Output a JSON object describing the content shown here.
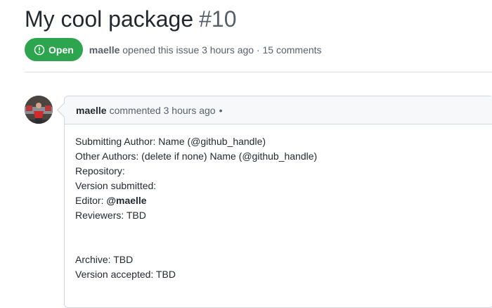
{
  "issue": {
    "title": "My cool package",
    "number": "#10",
    "state": "Open",
    "state_color": "#2da44e",
    "author": "maelle",
    "opened_text": "opened this issue 3 hours ago · 15 comments"
  },
  "comment": {
    "author": "maelle",
    "action": "commented 3 hours ago",
    "dot": "•",
    "lines": [
      "Submitting Author: Name (@github_handle)",
      "Other Authors: (delete if none) Name (@github_handle)",
      "Repository:",
      "Version submitted:",
      "Reviewers: TBD",
      "Archive: TBD",
      "Version accepted: TBD"
    ],
    "editor_label": "Editor:",
    "editor_handle": "@maelle"
  },
  "icons": {
    "state": "issue-opened-icon",
    "avatar": "avatar"
  }
}
